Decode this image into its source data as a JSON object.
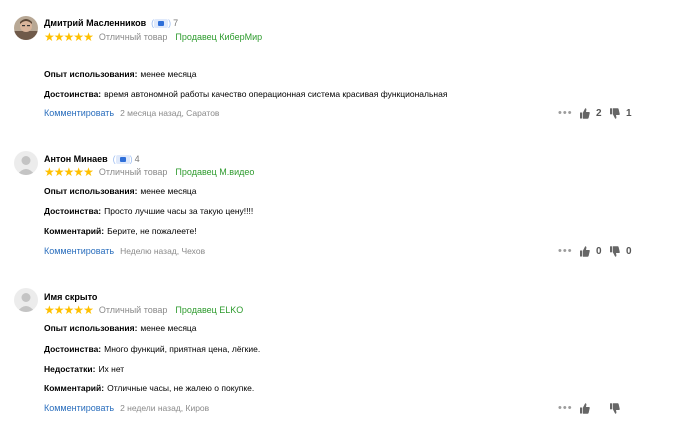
{
  "common": {
    "comment_label": "Комментировать",
    "experience_label": "Опыт использования:",
    "pros_label": "Достоинства:",
    "cons_label": "Недостатки:",
    "comment_field_label": "Комментарий:",
    "rating_text": "Отличный товар",
    "star_color": "#ffc000",
    "seller_color": "#2e9b2e",
    "link_color": "#2a6ebd"
  },
  "reviews": [
    {
      "author": "Дмитрий Масленников",
      "badge_count": "7",
      "rating": 5,
      "seller": "Продавец КиберМир",
      "experience": "менее месяца",
      "pros": "время автономной работы качество операционная система красивая функциональная",
      "meta": "2 месяца назад, Саратов",
      "likes": "2",
      "dislikes": "1",
      "avatar_icon": "photo-avatar-icon"
    },
    {
      "author": "Антон Минаев",
      "badge_count": "4",
      "rating": 5,
      "seller": "Продавец М.видео",
      "experience": "менее месяца",
      "pros": "Просто лучшие часы за такую цену!!!!",
      "comment": "Берите, не пожалеете!",
      "meta": "Неделю назад, Чехов",
      "likes": "0",
      "dislikes": "0",
      "avatar_icon": "default-avatar-icon"
    },
    {
      "author": "Имя скрыто",
      "rating": 5,
      "seller": "Продавец ELKO",
      "experience": "менее месяца",
      "pros": "Много функций, приятная цена, лёгкие.",
      "cons": "Их нет",
      "comment": "Отличные часы, не жалею о покупке.",
      "meta": "2 недели назад, Киров",
      "avatar_icon": "default-avatar-icon"
    }
  ]
}
